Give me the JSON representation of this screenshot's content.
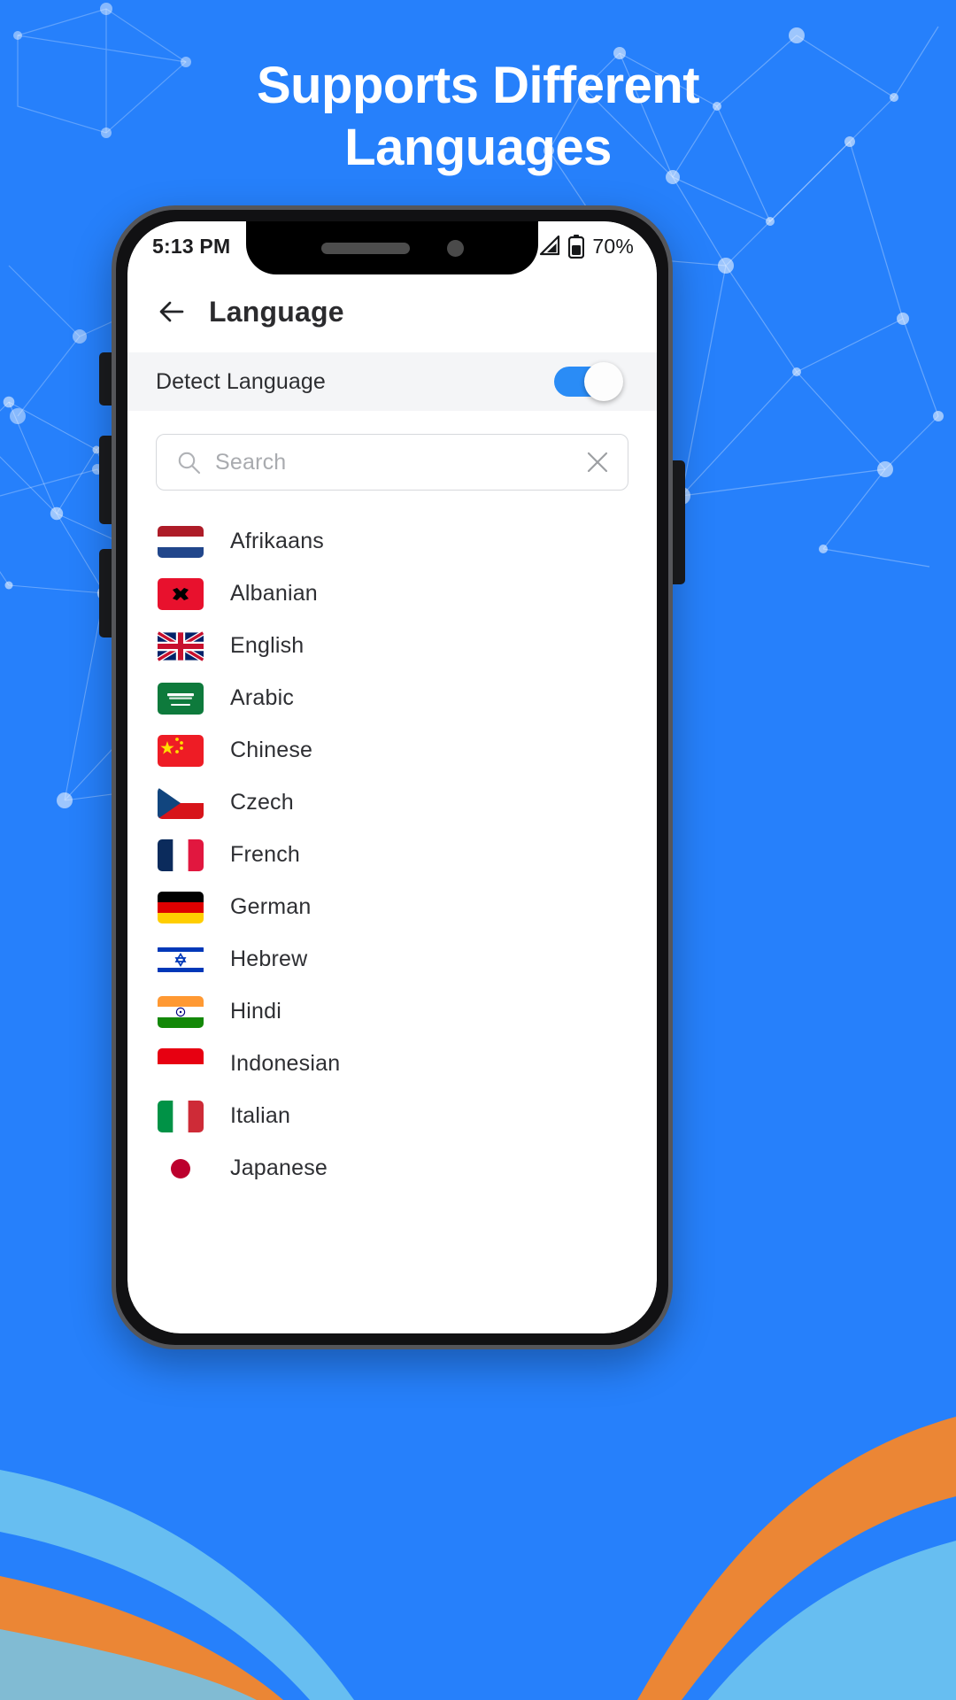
{
  "theme": {
    "brand_blue": "#2680fb",
    "accent_blue": "#2a8cf6",
    "orange": "#f5862a",
    "light_blue": "#6fc4ef"
  },
  "headline": {
    "line1": "Supports Different",
    "line2": "Languages"
  },
  "phone": {
    "statusbar": {
      "time": "5:13 PM",
      "battery_percent": "70%",
      "signal_icon": "signal-icon",
      "battery_icon": "battery-icon"
    },
    "appbar": {
      "back_icon": "back-arrow-icon",
      "title": "Language"
    },
    "detect": {
      "label": "Detect Language",
      "toggle_state": "on"
    },
    "search": {
      "placeholder": "Search",
      "value": "",
      "search_icon": "search-icon",
      "clear_icon": "close-icon"
    },
    "languages": [
      {
        "name": "Afrikaans",
        "flag": "flag-netherlands"
      },
      {
        "name": "Albanian",
        "flag": "flag-albania"
      },
      {
        "name": "English",
        "flag": "flag-united-kingdom"
      },
      {
        "name": "Arabic",
        "flag": "flag-saudi-arabia"
      },
      {
        "name": "Chinese",
        "flag": "flag-china"
      },
      {
        "name": "Czech",
        "flag": "flag-czech-republic"
      },
      {
        "name": "French",
        "flag": "flag-france"
      },
      {
        "name": "German",
        "flag": "flag-germany"
      },
      {
        "name": "Hebrew",
        "flag": "flag-israel"
      },
      {
        "name": "Hindi",
        "flag": "flag-india"
      },
      {
        "name": "Indonesian",
        "flag": "flag-indonesia"
      },
      {
        "name": "Italian",
        "flag": "flag-italy"
      },
      {
        "name": "Japanese",
        "flag": "flag-japan"
      }
    ]
  }
}
